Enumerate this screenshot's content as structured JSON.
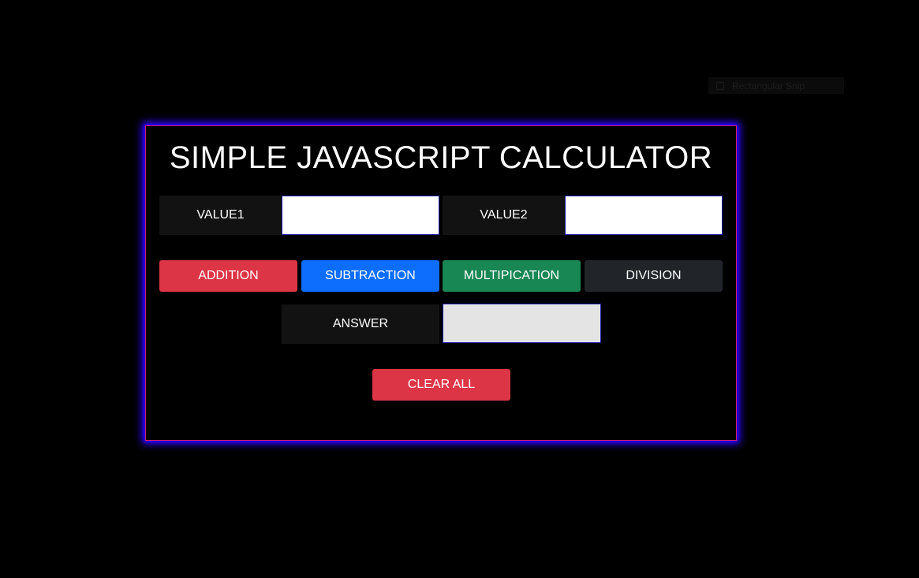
{
  "snip_overlay": {
    "label": "Rectangular Snip",
    "icon": "snip-icon"
  },
  "calculator": {
    "title": "SIMPLE JAVASCRIPT CALCULATOR",
    "value1_label": "VALUE1",
    "value1_input": "",
    "value2_label": "VALUE2",
    "value2_input": "",
    "answer_label": "ANSWER",
    "answer_value": "",
    "buttons": {
      "addition": "ADDITION",
      "subtraction": "SUBTRACTION",
      "multiplication": "MULTIPICATION",
      "division": "DIVISION",
      "clear_all": "CLEAR ALL"
    },
    "colors": {
      "addition": "#dc3545",
      "subtraction": "#0d6efd",
      "multiplication": "#198754",
      "division": "#212529",
      "clear_all": "#dc3545",
      "card_border": "#d01e6e",
      "card_glow": "#2a00ff",
      "label_bg": "#121212",
      "answer_bg": "#e4e4e4"
    }
  }
}
